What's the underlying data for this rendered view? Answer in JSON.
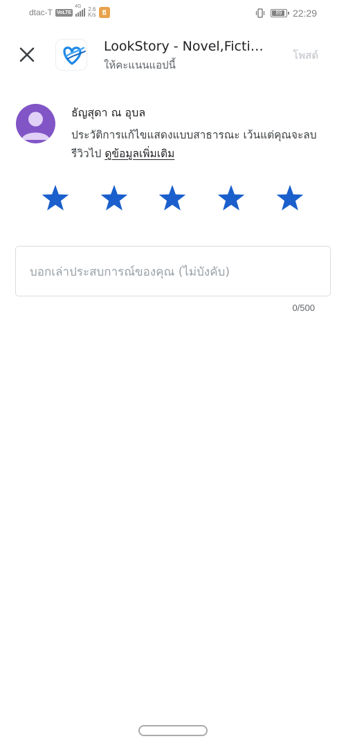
{
  "status_bar": {
    "carrier": "dtac-T",
    "volte": "VoLTE",
    "network": "4G",
    "speed_value": "2.6",
    "speed_unit": "K/s",
    "battery": "89",
    "time": "22:29"
  },
  "header": {
    "app_title": "LookStory - Novel,Fiction & Comics",
    "subtitle": "ให้คะแนนแอปนี้",
    "post_label": "โพสต์"
  },
  "user": {
    "name": "ธัญสุดา ณ อุบล",
    "notice": "ประวัติการแก้ไขแสดงแบบสาธารณะ เว้นแต่คุณจะลบรีวิวไป",
    "more_link": "ดูข้อมูลเพิ่มเติม"
  },
  "rating": {
    "max": 5,
    "selected": 5,
    "star_color": "#1a5fcc"
  },
  "review": {
    "placeholder": "บอกเล่าประสบการณ์ของคุณ (ไม่บังคับ)",
    "value": "",
    "counter": "0/500"
  },
  "colors": {
    "avatar_bg": "#8155c6",
    "avatar_fg": "#e1d1f7"
  }
}
